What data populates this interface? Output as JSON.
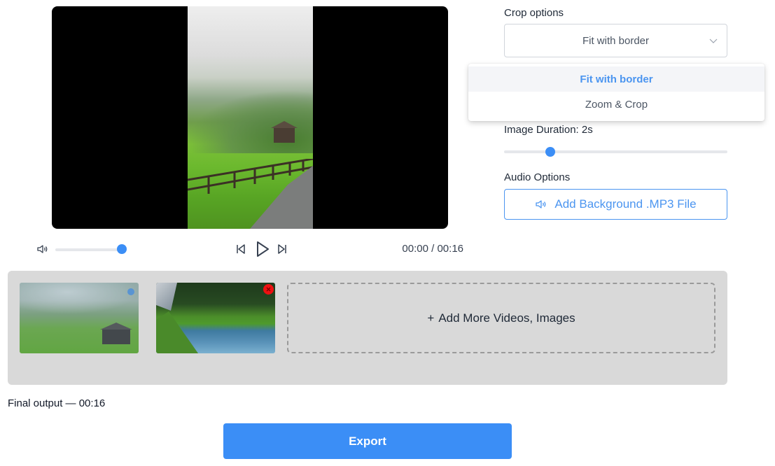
{
  "player": {
    "time_display": "00:00 / 00:16",
    "volume_percent": 100,
    "icons": {
      "volume": "speaker-icon",
      "prev": "skip-back-icon",
      "play": "play-icon",
      "next": "skip-forward-icon"
    }
  },
  "crop": {
    "label": "Crop options",
    "selected": "Fit with border",
    "options": [
      {
        "label": "Fit with border",
        "active": true
      },
      {
        "label": "Zoom & Crop",
        "active": false
      }
    ]
  },
  "image_duration": {
    "label": "Image Duration: 2s",
    "value_seconds": 2,
    "slider_fraction": 0.2
  },
  "audio": {
    "label": "Audio Options",
    "button_label": "Add Background .MP3 File",
    "icon": "speaker-icon"
  },
  "tray": {
    "items": [
      {
        "type": "video",
        "description": "misty green valley with barn",
        "selected": true
      },
      {
        "type": "image",
        "description": "mountain river with forest",
        "removable": true
      }
    ],
    "add_more_label": "Add More Videos, Images",
    "add_icon": "+"
  },
  "footer": {
    "final_output": "Final output — 00:16",
    "export_label": "Export"
  },
  "colors": {
    "accent": "#3b8ef6",
    "accent_text": "#4b95f0",
    "delete": "#ee1111",
    "tray_bg": "#d9d9d9"
  }
}
